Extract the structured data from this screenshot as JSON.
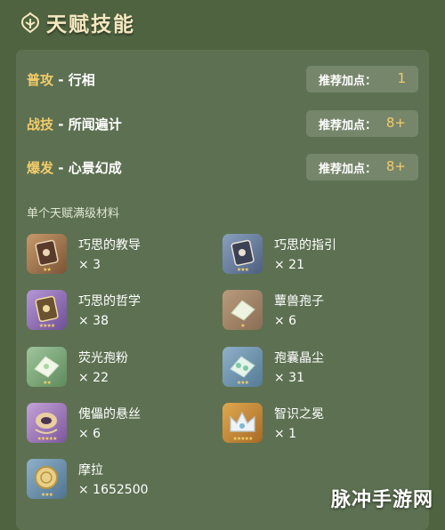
{
  "header": {
    "title": "天赋技能",
    "icon": "talent-icon"
  },
  "skills": [
    {
      "type": "普攻",
      "sep": " - ",
      "name": "行相",
      "label": "推荐加点：",
      "value": "1"
    },
    {
      "type": "战技",
      "sep": " - ",
      "name": "所闻遍计",
      "label": "推荐加点：",
      "value": "8+"
    },
    {
      "type": "爆发",
      "sep": " - ",
      "name": "心景幻成",
      "label": "推荐加点：",
      "value": "8+"
    }
  ],
  "materials_title": "单个天赋满级材料",
  "materials": [
    {
      "name": "巧思的教导",
      "qty": "× 3",
      "icon": "book-icon",
      "stars": "★★"
    },
    {
      "name": "巧思的指引",
      "qty": "× 21",
      "icon": "book-icon",
      "stars": "★★★"
    },
    {
      "name": "巧思的哲学",
      "qty": "× 38",
      "icon": "book-icon",
      "stars": "★★★★"
    },
    {
      "name": "蕈兽孢子",
      "qty": "× 6",
      "icon": "spore-icon",
      "stars": "★"
    },
    {
      "name": "荧光孢粉",
      "qty": "× 22",
      "icon": "powder-icon",
      "stars": "★★"
    },
    {
      "name": "孢囊晶尘",
      "qty": "× 31",
      "icon": "crystal-dust-icon",
      "stars": "★★★"
    },
    {
      "name": "傀儡的悬丝",
      "qty": "× 6",
      "icon": "puppet-string-icon",
      "stars": "★★★★★"
    },
    {
      "name": "智识之冕",
      "qty": "× 1",
      "icon": "crown-icon",
      "stars": "★★★★★"
    },
    {
      "name": "摩拉",
      "qty": "× 1652500",
      "icon": "mora-coin-icon",
      "stars": "★★★"
    }
  ],
  "watermark": "脉冲手游网",
  "colors": {
    "background": "#4f6340",
    "panel": "#5d7152",
    "accent": "#f2cc6a",
    "pill": "#76866b"
  }
}
